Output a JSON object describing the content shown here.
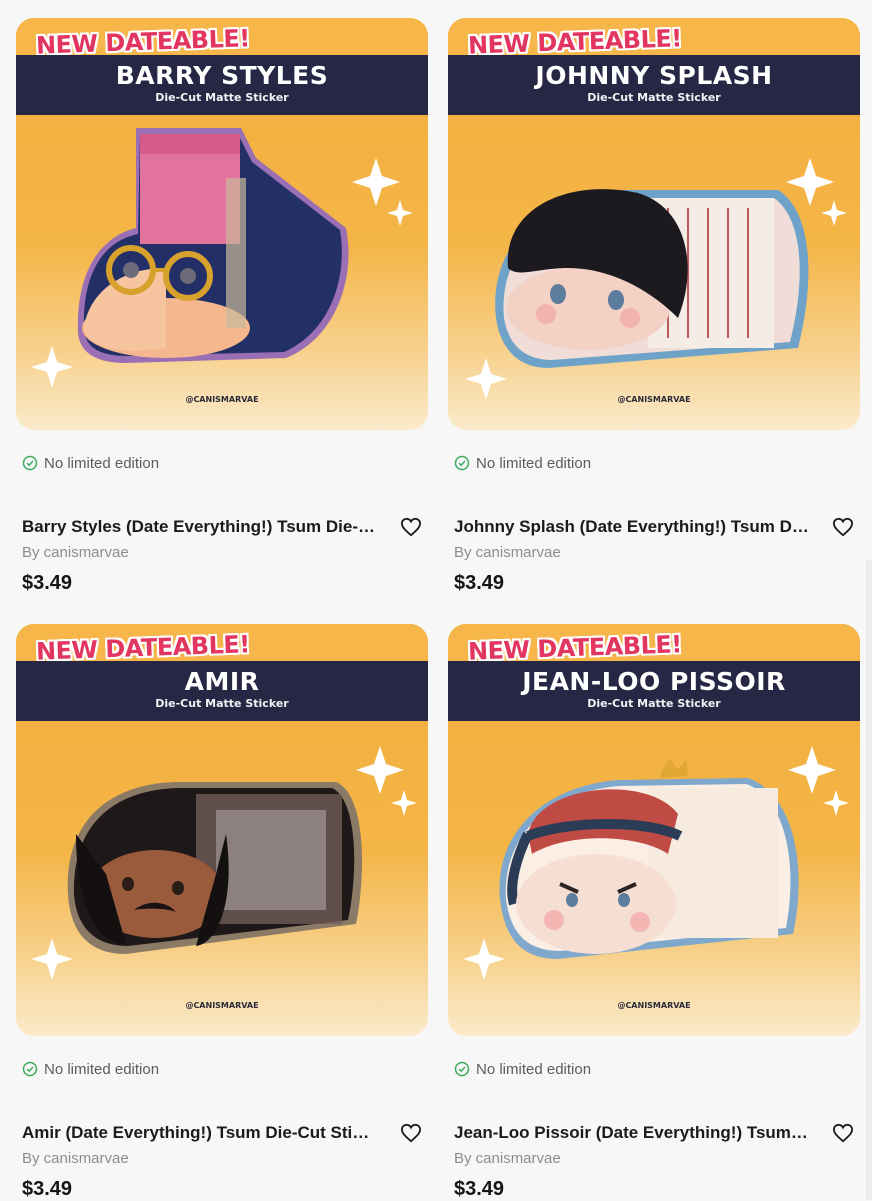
{
  "cards": [
    {
      "tag": "NEW DATEABLE!",
      "banner_title": "BARRY STYLES",
      "banner_sub": "Die-Cut Matte Sticker",
      "credit": "@CANISMARVAE",
      "badge": "No limited edition",
      "title": "Barry Styles (Date Everything!) Tsum Die-Cut Sticker",
      "author": "By canismarvae",
      "price": "$3.49",
      "rim_color": "#9b6fb4"
    },
    {
      "tag": "NEW DATEABLE!",
      "banner_title": "JOHNNY SPLASH",
      "banner_sub": "Die-Cut Matte Sticker",
      "credit": "@CANISMARVAE",
      "badge": "No limited edition",
      "title": "Johnny Splash (Date Everything!) Tsum Die-Cut Sticker",
      "author": "By canismarvae",
      "price": "$3.49",
      "rim_color": "#6fa2c8"
    },
    {
      "tag": "NEW DATEABLE!",
      "banner_title": "AMIR",
      "banner_sub": "Die-Cut Matte Sticker",
      "credit": "@CANISMARVAE",
      "badge": "No limited edition",
      "title": "Amir (Date Everything!) Tsum Die-Cut Sticker",
      "author": "By canismarvae",
      "price": "$3.49",
      "rim_color": "#8a7a66"
    },
    {
      "tag": "NEW DATEABLE!",
      "banner_title": "JEAN-LOO PISSOIR",
      "banner_sub": "Die-Cut Matte Sticker",
      "credit": "@CANISMARVAE",
      "badge": "No limited edition",
      "title": "Jean-Loo Pissoir (Date Everything!) Tsum Die-Cut Sticker",
      "author": "By canismarvae",
      "price": "$3.49",
      "rim_color": "#7fa8cc"
    }
  ],
  "colors": {
    "banner": "#262744",
    "tag_text": "#e2355f",
    "badge_check": "#3daa5c",
    "price": "#151515"
  },
  "icons": {
    "badge": "check-circle-icon",
    "favorite": "heart-outline-icon"
  }
}
